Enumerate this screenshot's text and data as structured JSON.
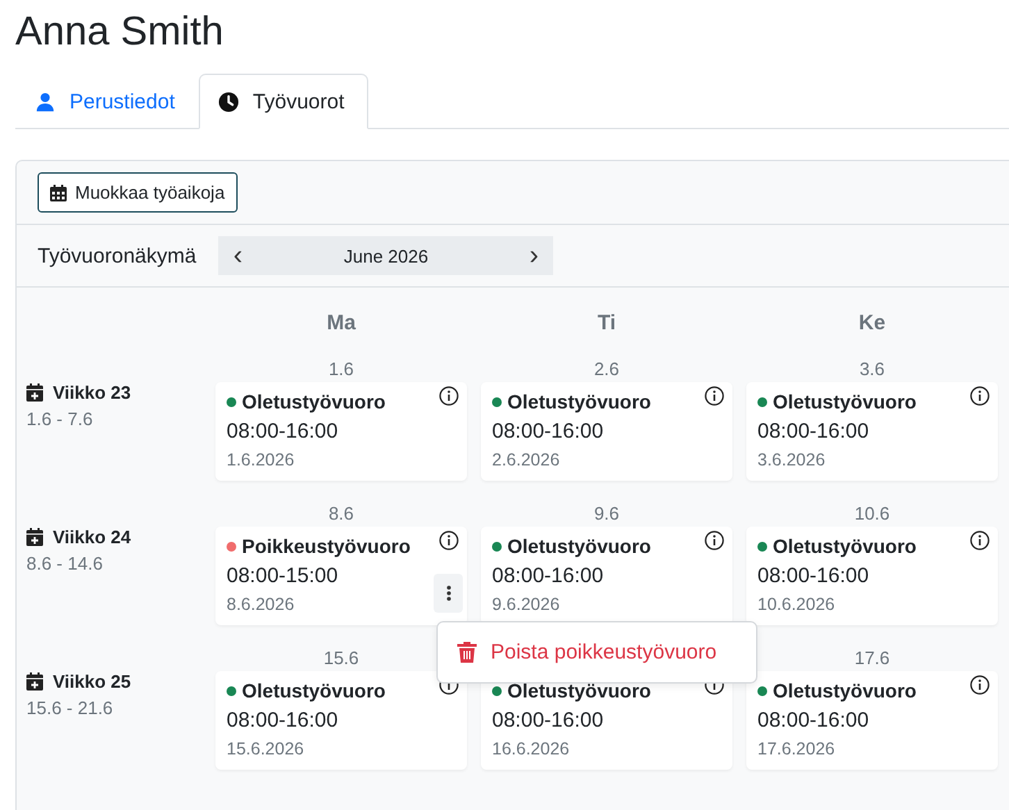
{
  "page_title": "Anna Smith",
  "tabs": [
    {
      "label": "Perustiedot",
      "selected": false
    },
    {
      "label": "Työvuorot",
      "selected": true
    }
  ],
  "toolbar": {
    "edit_button": "Muokkaa työaikoja"
  },
  "view": {
    "label": "Työvuoronäkymä",
    "prev": "‹",
    "month": "June 2026",
    "next": "›"
  },
  "day_headers": [
    "Ma",
    "Ti",
    "Ke"
  ],
  "weeks": [
    {
      "label": "Viikko 23",
      "range": "1.6 - 7.6",
      "days": [
        {
          "day": "1.6",
          "title": "Oletustyövuoro",
          "color": "#198754",
          "time": "08:00-16:00",
          "date": "1.6.2026",
          "menu_button": false
        },
        {
          "day": "2.6",
          "title": "Oletustyövuoro",
          "color": "#198754",
          "time": "08:00-16:00",
          "date": "2.6.2026",
          "menu_button": false
        },
        {
          "day": "3.6",
          "title": "Oletustyövuoro",
          "color": "#198754",
          "time": "08:00-16:00",
          "date": "3.6.2026",
          "menu_button": false
        }
      ]
    },
    {
      "label": "Viikko 24",
      "range": "8.6 - 14.6",
      "days": [
        {
          "day": "8.6",
          "title": "Poikkeustyövuoro",
          "color": "#f06c6c",
          "time": "08:00-15:00",
          "date": "8.6.2026",
          "menu_button": true,
          "menu": {
            "items": [
              {
                "kind": "delete",
                "label": "Poista poikkeustyövuoro"
              }
            ]
          }
        },
        {
          "day": "9.6",
          "title": "Oletustyövuoro",
          "color": "#198754",
          "time": "08:00-16:00",
          "date": "9.6.2026",
          "menu_button": false
        },
        {
          "day": "10.6",
          "title": "Oletustyövuoro",
          "color": "#198754",
          "time": "08:00-16:00",
          "date": "10.6.2026",
          "menu_button": false
        }
      ]
    },
    {
      "label": "Viikko 25",
      "range": "15.6 - 21.6",
      "days": [
        {
          "day": "15.6",
          "title": "Oletustyövuoro",
          "color": "#198754",
          "time": "08:00-16:00",
          "date": "15.6.2026",
          "menu_button": false
        },
        {
          "title": "Oletustyövuoro",
          "color": "#198754",
          "time": "08:00-16:00",
          "date": "16.6.2026",
          "menu_button": false
        },
        {
          "day": "17.6",
          "title": "Oletustyövuoro",
          "color": "#198754",
          "time": "08:00-16:00",
          "date": "17.6.2026",
          "menu_button": false
        }
      ]
    }
  ]
}
